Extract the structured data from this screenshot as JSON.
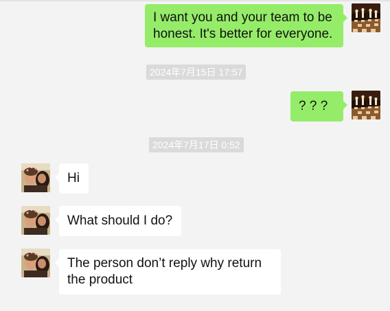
{
  "messages": [
    {
      "type": "message",
      "direction": "outgoing",
      "avatar_icon": "chess-board-avatar-icon",
      "lines": [
        "I want you and your team to be",
        "honest. It's better for everyone."
      ]
    },
    {
      "type": "timestamp",
      "text": "2024年7月15日 17:57"
    },
    {
      "type": "message",
      "direction": "outgoing",
      "avatar_icon": "chess-board-avatar-icon",
      "lines": [
        "? ? ?"
      ]
    },
    {
      "type": "timestamp",
      "text": "2024年7月17日 0:52"
    },
    {
      "type": "message",
      "direction": "incoming",
      "avatar_icon": "couple-photo-avatar-icon",
      "lines": [
        "Hi"
      ]
    },
    {
      "type": "message",
      "direction": "incoming",
      "avatar_icon": "couple-photo-avatar-icon",
      "lines": [
        "What should I do?"
      ]
    },
    {
      "type": "message",
      "direction": "incoming",
      "avatar_icon": "couple-photo-avatar-icon",
      "lines": [
        "The person don’t reply why return",
        "the product"
      ]
    }
  ],
  "colors": {
    "background": "#f3f3f3",
    "outgoing_bubble": "#95ec69",
    "incoming_bubble": "#ffffff",
    "timestamp_bg": "#dadada",
    "timestamp_text": "#ffffff"
  }
}
